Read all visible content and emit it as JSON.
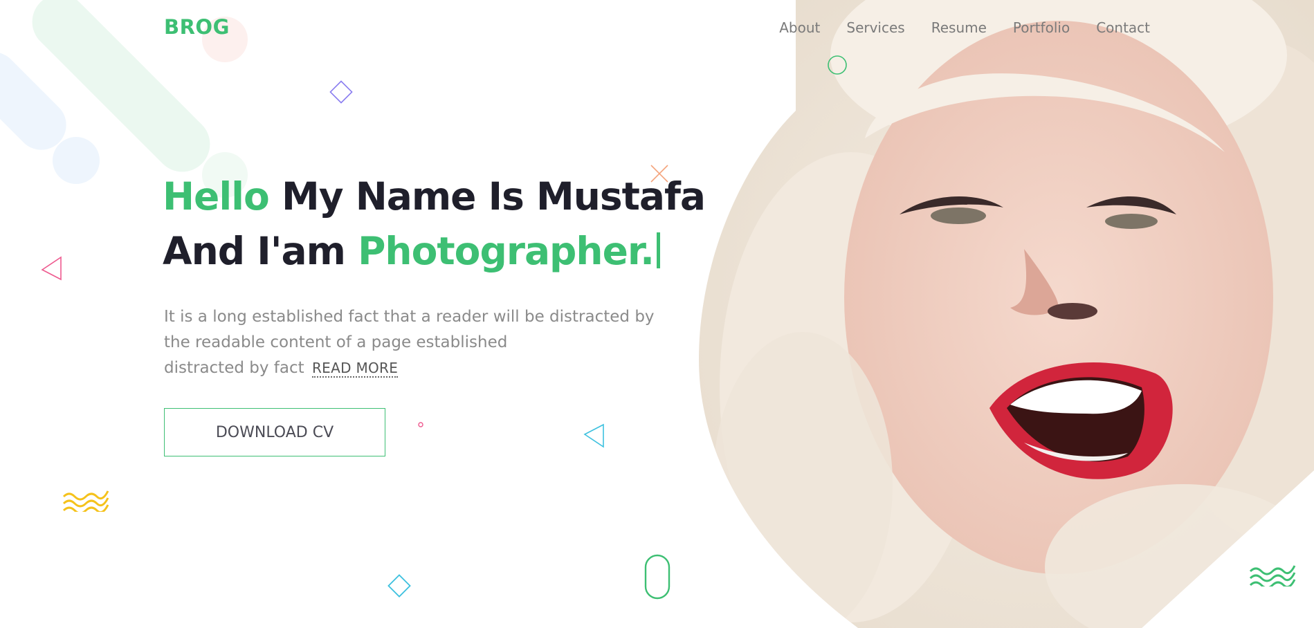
{
  "brand": {
    "logo": "BROG",
    "accent": "#3dbf73",
    "heading_color": "#1f1f2b"
  },
  "nav": {
    "items": [
      {
        "label": "About"
      },
      {
        "label": "Services"
      },
      {
        "label": "Resume"
      },
      {
        "label": "Portfolio"
      },
      {
        "label": "Contact"
      }
    ]
  },
  "hero": {
    "line1_green": "Hello",
    "line1_dark": "My Name Is Mustafa",
    "line2_dark": "And I'am",
    "line2_green": "Photographer.",
    "paragraph_line1": "It is a long established fact that a reader will be distracted by",
    "paragraph_line2": "the readable content of a page established",
    "paragraph_line3": "distracted by fact",
    "read_more": "READ MORE",
    "cv_button": "DOWNLOAD CV"
  },
  "decorations": {
    "icons": [
      "diamond-shape",
      "circle-shape",
      "cross-shape",
      "triangle-shape",
      "squiggle-shape",
      "pill-shape"
    ],
    "colors": {
      "purple": "#8a7df0",
      "green": "#3dbf73",
      "orange": "#f4a47c",
      "pink": "#ee5a8f",
      "cyan": "#3ec1df",
      "yellow": "#f5c21b"
    }
  },
  "portrait": {
    "alt": "woman in fur hood laughing"
  }
}
